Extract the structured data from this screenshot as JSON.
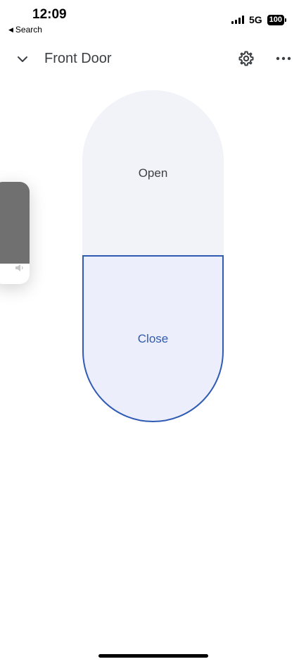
{
  "status_bar": {
    "time": "12:09",
    "back_label": "Search",
    "network": "5G",
    "battery": "100"
  },
  "header": {
    "title": "Front Door",
    "back_icon": "chevron-down-icon",
    "settings_icon": "gear-icon",
    "more_icon": "more-horizontal-icon"
  },
  "volume": {
    "level": 0.8,
    "icon": "speaker-icon"
  },
  "control": {
    "open_label": "Open",
    "close_label": "Close",
    "selected": "Close"
  },
  "colors": {
    "accent": "#2f5bb3",
    "open_bg": "#f1f3f8",
    "close_bg": "#eceefb"
  }
}
